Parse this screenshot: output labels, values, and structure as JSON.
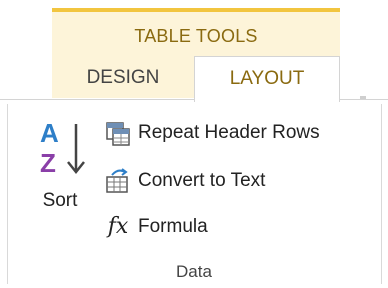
{
  "context": {
    "title": "TABLE TOOLS",
    "accent_color": "#f2c53f",
    "background_color": "#fdf4d9"
  },
  "tabs": [
    {
      "label": "DESIGN",
      "active": false
    },
    {
      "label": "LAYOUT",
      "active": true
    }
  ],
  "group": {
    "label": "Data",
    "sort": {
      "label": "Sort",
      "icon": "sort-az-icon"
    },
    "commands": [
      {
        "label": "Repeat Header Rows",
        "icon": "repeat-header-rows-icon"
      },
      {
        "label": "Convert to Text",
        "icon": "convert-to-text-icon"
      },
      {
        "label": "Formula",
        "icon": "formula-fx-icon"
      }
    ]
  }
}
